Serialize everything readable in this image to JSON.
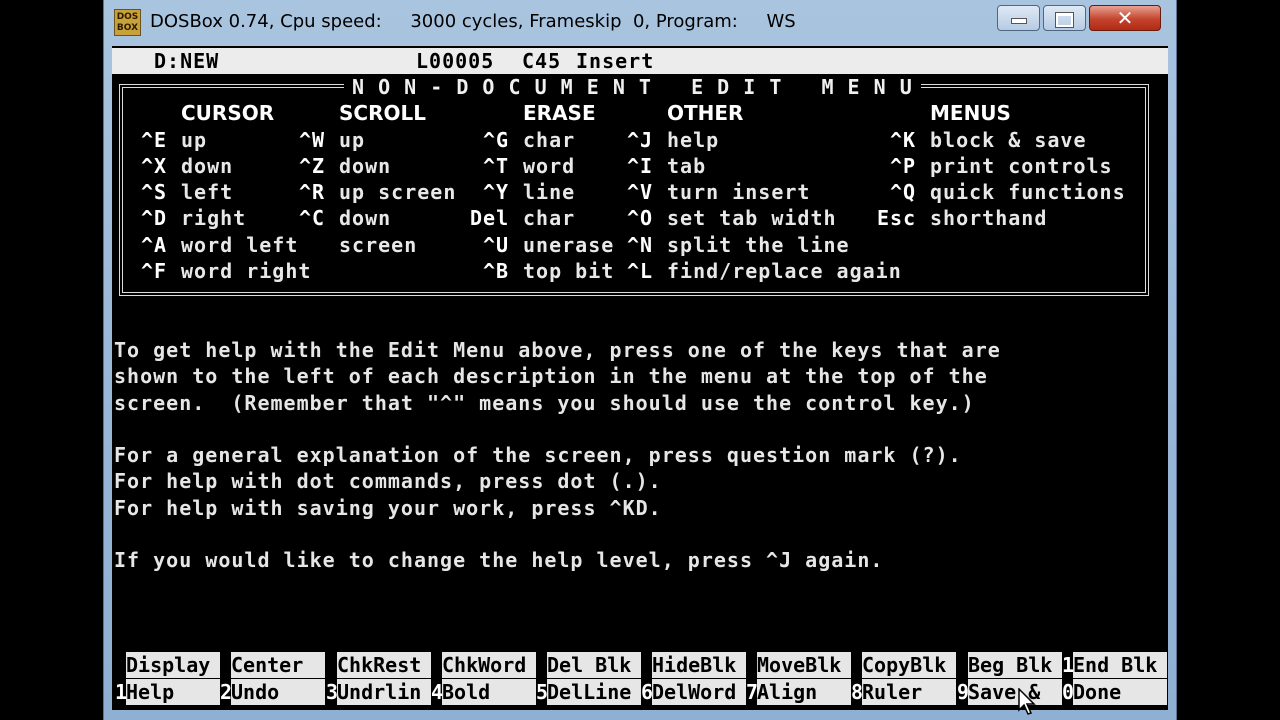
{
  "window": {
    "icon_text": "DOS\nBOX",
    "title": "DOSBox 0.74, Cpu speed:     3000 cycles, Frameskip  0, Program:     WS"
  },
  "status": {
    "file": "D:NEW",
    "line": "L00005",
    "column": "C45",
    "mode": "Insert"
  },
  "menu": {
    "title": "N O N - D O C U M E N T   E D I T   M E N U",
    "columns": [
      {
        "header": "CURSOR",
        "items": [
          {
            "key": "^E",
            "label": "up"
          },
          {
            "key": "^X",
            "label": "down"
          },
          {
            "key": "^S",
            "label": "left"
          },
          {
            "key": "^D",
            "label": "right"
          },
          {
            "key": "^A",
            "label": "word left"
          },
          {
            "key": "^F",
            "label": "word right"
          }
        ]
      },
      {
        "header": "SCROLL",
        "items": [
          {
            "key": "^W",
            "label": "up"
          },
          {
            "key": "^Z",
            "label": "down"
          },
          {
            "key": "^R",
            "label": "up screen"
          },
          {
            "key": "^C",
            "label": "down"
          },
          {
            "key": "",
            "label": "screen"
          }
        ]
      },
      {
        "header": "ERASE",
        "items": [
          {
            "key": "^G",
            "label": "char"
          },
          {
            "key": "^T",
            "label": "word"
          },
          {
            "key": "^Y",
            "label": "line"
          },
          {
            "key": "Del",
            "label": "char"
          },
          {
            "key": "^U",
            "label": "unerase"
          },
          {
            "key": "^B",
            "label": "top bit"
          }
        ]
      },
      {
        "header": "OTHER",
        "items": [
          {
            "key": "^J",
            "label": "help"
          },
          {
            "key": "^I",
            "label": "tab"
          },
          {
            "key": "^V",
            "label": "turn insert"
          },
          {
            "key": "^O",
            "label": "set tab width"
          },
          {
            "key": "^N",
            "label": "split the line"
          },
          {
            "key": "^L",
            "label": "find/replace again"
          }
        ]
      },
      {
        "header": "MENUS",
        "items": [
          {
            "key": "^K",
            "label": "block & save"
          },
          {
            "key": "^P",
            "label": "print controls"
          },
          {
            "key": "^Q",
            "label": "quick functions"
          },
          {
            "key": "Esc",
            "label": "shorthand"
          }
        ]
      }
    ]
  },
  "help": {
    "lines": [
      "To get help with the Edit Menu above, press one of the keys that are",
      "shown to the left of each description in the menu at the top of the",
      "screen.  (Remember that \"^\" means you should use the control key.)",
      "",
      "For a general explanation of the screen, press question mark (?).",
      "For help with dot commands, press dot (.).",
      "For help with saving your work, press ^KD.",
      "",
      "If you would like to change the help level, press ^J again."
    ]
  },
  "function_keys": {
    "shift_labels": [
      "Display",
      "Center",
      "ChkRest",
      "ChkWord",
      "Del Blk",
      "HideBlk",
      "MoveBlk",
      "CopyBlk",
      "Beg Blk",
      "End Blk"
    ],
    "numbers": [
      "1",
      "2",
      "3",
      "4",
      "5",
      "6",
      "7",
      "8",
      "9",
      "0"
    ],
    "actions": [
      "Help",
      "Undo",
      "Undrlin",
      "Bold",
      "DelLine",
      "DelWord",
      "Align",
      "Ruler",
      "Save &",
      "Done"
    ],
    "end_prefix": "1"
  }
}
